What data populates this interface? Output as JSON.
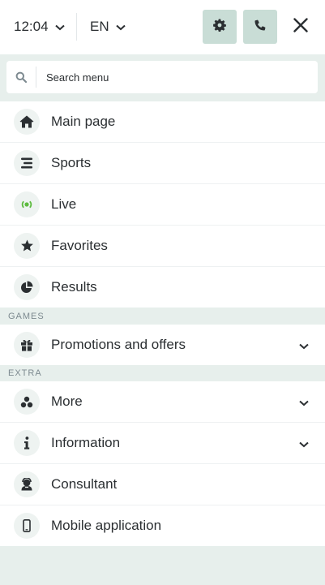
{
  "header": {
    "time": "12:04",
    "language": "EN"
  },
  "search": {
    "placeholder": "Search menu"
  },
  "menu_items": [
    {
      "label": "Main page",
      "icon": "home-icon"
    },
    {
      "label": "Sports",
      "icon": "list-icon"
    },
    {
      "label": "Live",
      "icon": "live-broadcast-icon"
    },
    {
      "label": "Favorites",
      "icon": "star-icon"
    },
    {
      "label": "Results",
      "icon": "pie-chart-icon"
    }
  ],
  "sections": {
    "games": "GAMES",
    "extra": "EXTRA"
  },
  "games_items": [
    {
      "label": "Promotions and offers",
      "icon": "gift-icon"
    }
  ],
  "extra_items": [
    {
      "label": "More",
      "icon": "dots-cluster-icon"
    },
    {
      "label": "Information",
      "icon": "info-icon"
    },
    {
      "label": "Consultant",
      "icon": "consultant-icon"
    },
    {
      "label": "Mobile application",
      "icon": "mobile-icon"
    }
  ],
  "colors": {
    "accent": "#c9ddd6",
    "background": "#e7efec",
    "live_green": "#5dbb3f",
    "text": "#2b2f32"
  }
}
